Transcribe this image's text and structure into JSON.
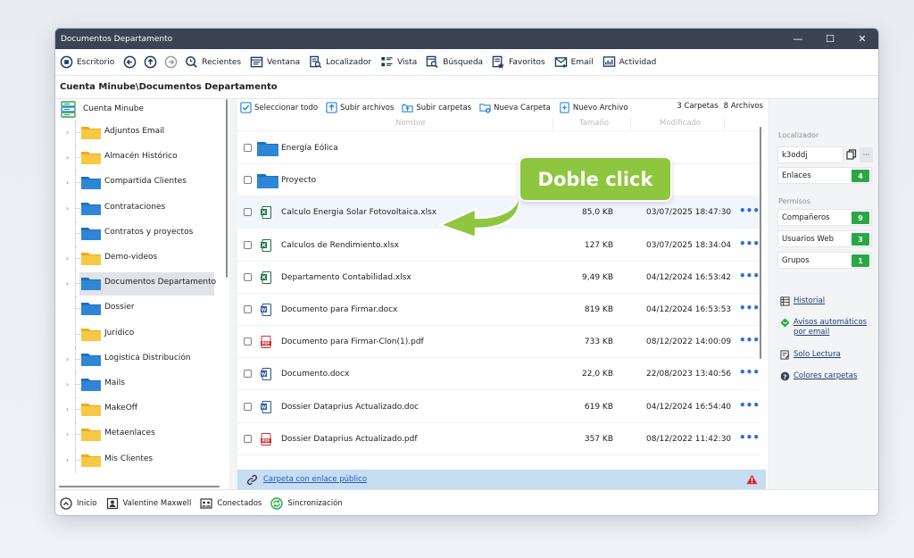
{
  "window": {
    "title": "Documentos Departamento"
  },
  "toolbar": {
    "escritorio": "Escritorio",
    "recientes": "Recientes",
    "ventana": "Ventana",
    "localizador": "Localizador",
    "vista": "Vista",
    "busqueda": "Búsqueda",
    "favoritos": "Favoritos",
    "email": "Email",
    "actividad": "Actividad"
  },
  "path": "Cuenta Minube\\Documentos Departamento",
  "tree": {
    "root": "Cuenta Minube",
    "items": [
      {
        "label": "Adjuntos Email",
        "color": "yellow",
        "expand": true
      },
      {
        "label": "Almacén Histórico",
        "color": "yellow",
        "expand": true
      },
      {
        "label": "Compartida Clientes",
        "color": "blue",
        "expand": true
      },
      {
        "label": "Contrataciones",
        "color": "blue",
        "expand": true
      },
      {
        "label": "Contratos y proyectos",
        "color": "blue",
        "expand": false
      },
      {
        "label": "Demo-videos",
        "color": "yellow",
        "expand": true
      },
      {
        "label": "Documentos Departamento",
        "color": "blue",
        "expand": true,
        "selected": true
      },
      {
        "label": "Dossier",
        "color": "blue",
        "expand": false
      },
      {
        "label": "Juridico",
        "color": "yellow",
        "expand": false
      },
      {
        "label": "Logistica Distribución",
        "color": "blue",
        "expand": true
      },
      {
        "label": "Mails",
        "color": "blue",
        "expand": true
      },
      {
        "label": "MakeOff",
        "color": "yellow",
        "expand": true
      },
      {
        "label": "Metaenlaces",
        "color": "yellow",
        "expand": true
      },
      {
        "label": "Mis Clientes",
        "color": "yellow",
        "expand": true
      }
    ]
  },
  "files_toolbar": {
    "select_all": "Seleccionar todo",
    "upload_files": "Subir archivos",
    "upload_folders": "Subir carpetas",
    "new_folder": "Nueva Carpeta",
    "new_file": "Nuevo Archivo",
    "folder_count": "3 Carpetas",
    "file_count": "8 Archivos"
  },
  "columns": {
    "name": "Nombre",
    "size": "Tamaño",
    "modified": "Modificado"
  },
  "rows": [
    {
      "type": "folder",
      "name": "Energía Eólica",
      "size": "",
      "date": ""
    },
    {
      "type": "folder",
      "name": "Proyecto",
      "size": "",
      "date": ""
    },
    {
      "type": "xlsx",
      "name": "Calculo Energia Solar Fotovoltaica.xlsx",
      "size": "85,0 KB",
      "date": "03/07/2025 18:47:30",
      "highlight": true
    },
    {
      "type": "xlsx",
      "name": "Calculos de Rendimiento.xlsx",
      "size": "127 KB",
      "date": "03/07/2025 18:34:04"
    },
    {
      "type": "xlsx",
      "name": "Departamento Contabilidad.xlsx",
      "size": "9,49 KB",
      "date": "04/12/2024 16:53:42"
    },
    {
      "type": "docx",
      "name": "Documento para Firmar.docx",
      "size": "819 KB",
      "date": "04/12/2024 16:53:53"
    },
    {
      "type": "pdf",
      "name": "Documento para Firmar-Clon(1).pdf",
      "size": "733 KB",
      "date": "08/12/2022 14:00:09"
    },
    {
      "type": "docx",
      "name": "Documento.docx",
      "size": "22,0 KB",
      "date": "22/08/2023 13:40:56"
    },
    {
      "type": "doc",
      "name": "Dossier Dataprius Actualizado.doc",
      "size": "619 KB",
      "date": "04/12/2024 16:54:40"
    },
    {
      "type": "pdf",
      "name": "Dossier Dataprius Actualizado.pdf",
      "size": "357 KB",
      "date": "08/12/2022 11:42:30"
    }
  ],
  "public_link": "Carpeta con enlace público",
  "right_panel": {
    "localizador_label": "Localizador",
    "localizador_value": "k3oddj",
    "enlaces": "Enlaces",
    "enlaces_count": "4",
    "permisos_label": "Permisos",
    "companeros": "Compañeros",
    "companeros_count": "9",
    "usuarios_web": "Usuarios Web",
    "usuarios_web_count": "3",
    "grupos": "Grupos",
    "grupos_count": "1",
    "historial": "Historial",
    "avisos_line1": "Avisos automáticos",
    "avisos_line2": "por email",
    "solo_lectura": "Solo Lectura",
    "colores": "Colores carpetas"
  },
  "status": {
    "inicio": "Inicio",
    "user": "Valentine Maxwell",
    "conectados": "Conectados",
    "sincronizacion": "Sincronización"
  },
  "callout": "Doble click",
  "colors": {
    "titlebar": "#3b4452",
    "accent_blue": "#1f5fb8",
    "badge_green": "#2aa745",
    "callout_green": "#8ec63f",
    "folder_yellow": "#f7c843",
    "folder_blue": "#2f86d6"
  }
}
